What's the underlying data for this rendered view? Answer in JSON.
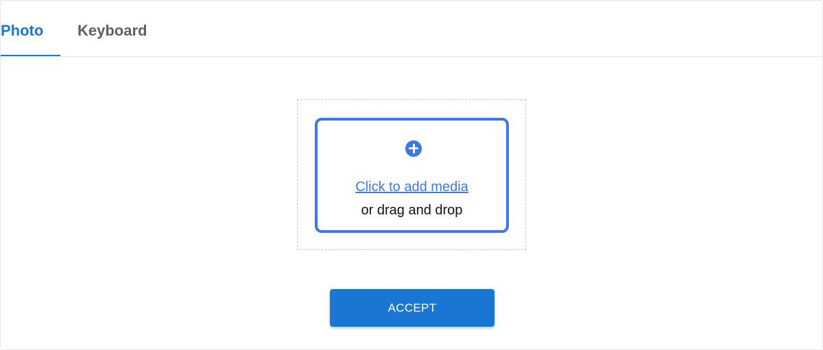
{
  "tabs": {
    "photo_label": "Photo",
    "keyboard_label": "Keyboard",
    "active": "Photo"
  },
  "upload": {
    "link_text": "Click to add media",
    "subtext": "or drag and drop",
    "icon": "plus-circle-icon"
  },
  "actions": {
    "accept_label": "ACCEPT"
  },
  "colors": {
    "primary": "#1976d2",
    "dropzone_border": "#3b78e7",
    "inactive_tab": "#5f5f5f"
  }
}
